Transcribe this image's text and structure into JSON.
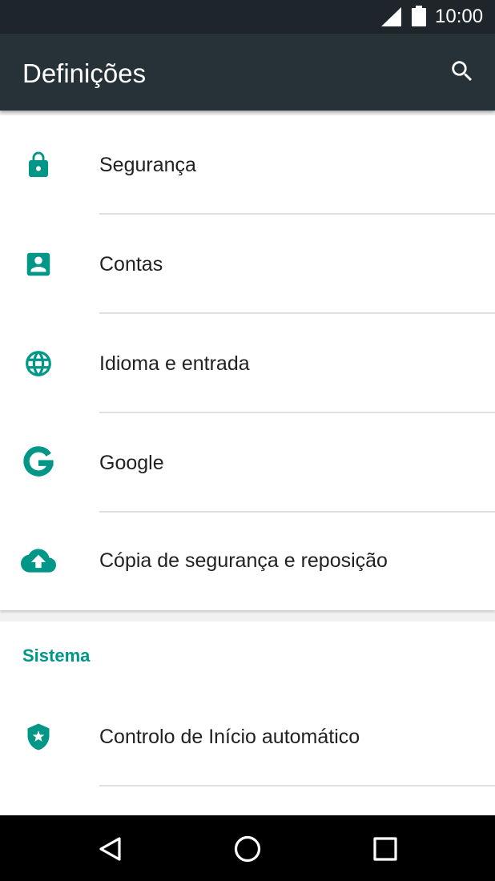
{
  "status_bar": {
    "time": "10:00",
    "icons": [
      "signal-icon",
      "battery-icon"
    ]
  },
  "app_bar": {
    "title": "Definições",
    "search_icon": "search-icon"
  },
  "accent_color": "#009688",
  "settings": {
    "items": [
      {
        "label": "Segurança",
        "icon": "lock-icon"
      },
      {
        "label": "Contas",
        "icon": "account-box-icon"
      },
      {
        "label": "Idioma e entrada",
        "icon": "globe-icon"
      },
      {
        "label": "Google",
        "icon": "google-icon"
      },
      {
        "label": "Cópia de segurança e reposição",
        "icon": "cloud-upload-icon"
      }
    ]
  },
  "system": {
    "header": "Sistema",
    "items": [
      {
        "label": "Controlo de Início automático",
        "icon": "shield-star-icon"
      }
    ]
  },
  "nav_bar": {
    "buttons": [
      "back-icon",
      "home-icon",
      "recents-icon"
    ]
  }
}
